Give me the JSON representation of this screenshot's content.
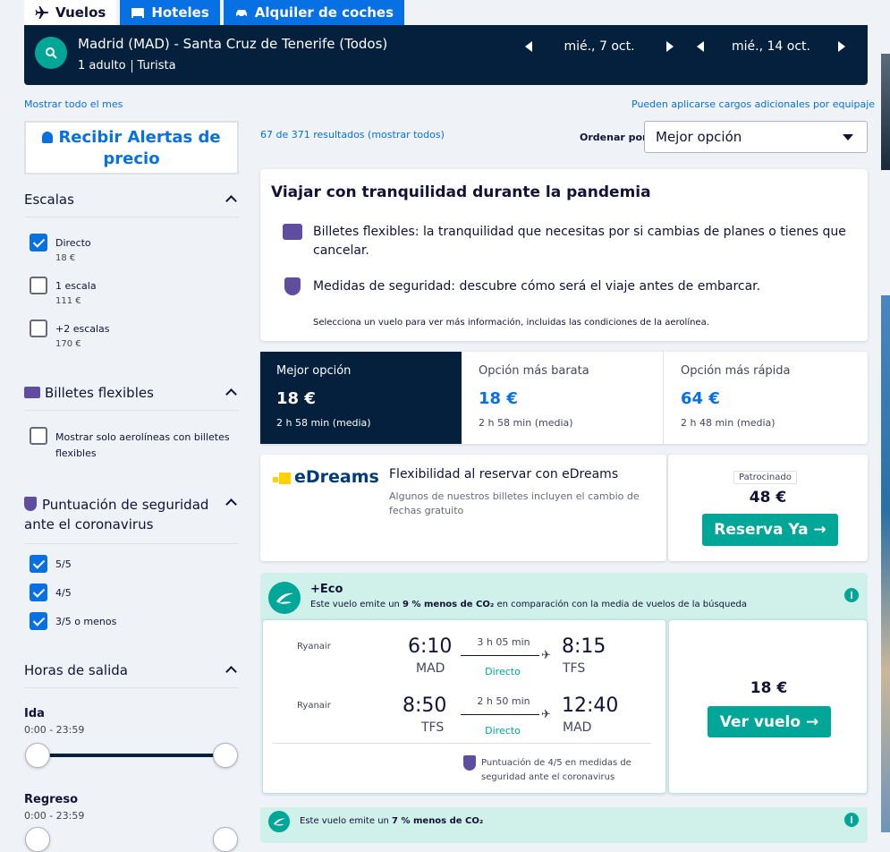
{
  "tabs": [
    {
      "label": "Vuelos",
      "icon": "plane-icon",
      "active": true
    },
    {
      "label": "Hoteles",
      "icon": "bed-icon",
      "active": false
    },
    {
      "label": "Alquiler de coches",
      "icon": "car-icon",
      "active": false
    }
  ],
  "search": {
    "route": "Madrid (MAD) - Santa Cruz de Tenerife (Todos)",
    "adults": "1 adulto",
    "cabin": "Turista",
    "depart_date": "mié., 7 oct.",
    "return_date": "mié., 14 oct."
  },
  "links": {
    "whole_month": "Mostrar todo el mes",
    "extra_fees": "Pueden aplicarse cargos adicionales por equipaje",
    "results": "67 de 371 resultados (mostrar todos)"
  },
  "sort": {
    "label": "Ordenar por",
    "value": "Mejor opción"
  },
  "sidebar": {
    "alert_button": "Recibir Alertas de precio",
    "stops_title": "Escalas",
    "stops": [
      {
        "label": "Directo",
        "price": "18 €",
        "checked": true
      },
      {
        "label": "1 escala",
        "price": "111 €",
        "checked": false
      },
      {
        "label": "+2 escalas",
        "price": "170 €",
        "checked": false
      }
    ],
    "flex_title": "Billetes flexibles",
    "flex_option": "Mostrar solo aerolíneas con billetes flexibles",
    "safety_title": "Puntuación de seguridad ante el coronavirus",
    "safety": [
      {
        "label": "5/5",
        "checked": true
      },
      {
        "label": "4/5",
        "checked": true
      },
      {
        "label": "3/5 o menos",
        "checked": true
      }
    ],
    "times_title": "Horas de salida",
    "outbound_label": "Ida",
    "outbound_range": "0:00 - 23:59",
    "return_label": "Regreso",
    "return_range": "0:00 - 23:59"
  },
  "pandemic": {
    "title": "Viajar con tranquilidad durante la pandemia",
    "flex_text": "Billetes flexibles: la tranquilidad que necesitas por si cambias de planes o tienes que cancelar.",
    "safety_text": "Medidas de seguridad: descubre cómo será el viaje antes de embarcar.",
    "note": "Selecciona un vuelo para ver más información, incluidas las condiciones de la aerolínea."
  },
  "price_tabs": [
    {
      "label": "Mejor opción",
      "price": "18 €",
      "duration": "2 h 58 min (media)",
      "active": true
    },
    {
      "label": "Opción más barata",
      "price": "18 €",
      "duration": "2 h 58 min (media)",
      "active": false
    },
    {
      "label": "Opción más rápida",
      "price": "64 €",
      "duration": "2 h 48 min (media)",
      "active": false
    }
  ],
  "ad": {
    "brand": "eDreams",
    "title": "Flexibilidad al reservar con eDreams",
    "desc": "Algunos de nuestros billetes incluyen el cambio de fechas gratuito",
    "sponsored": "Patrocinado",
    "price": "48 €",
    "button": "Reserva Ya →"
  },
  "eco": {
    "label": "+Eco",
    "text_pre": "Este vuelo emite un ",
    "text_bold": "9 % menos de CO₂",
    "text_post": " en comparación con la media de vuelos de la búsqueda"
  },
  "flight": {
    "legs": [
      {
        "airline": "Ryanair",
        "dep_time": "6:10",
        "dep_code": "MAD",
        "duration": "3 h 05 min",
        "stops": "Directo",
        "arr_time": "8:15",
        "arr_code": "TFS"
      },
      {
        "airline": "Ryanair",
        "dep_time": "8:50",
        "dep_code": "TFS",
        "duration": "2 h 50 min",
        "stops": "Directo",
        "arr_time": "12:40",
        "arr_code": "MAD"
      }
    ],
    "safety_note": "Puntuación de 4/5 en medidas de seguridad ante el coronavirus",
    "price": "18 €",
    "button": "Ver vuelo →"
  },
  "eco2": {
    "text_pre": "Este vuelo emite un ",
    "text_bold": "7 % menos de CO₂"
  },
  "colors": {
    "navy": "#05203c",
    "blue": "#0770e3",
    "teal": "#00a698",
    "eco_bg": "#d0f0ea"
  }
}
